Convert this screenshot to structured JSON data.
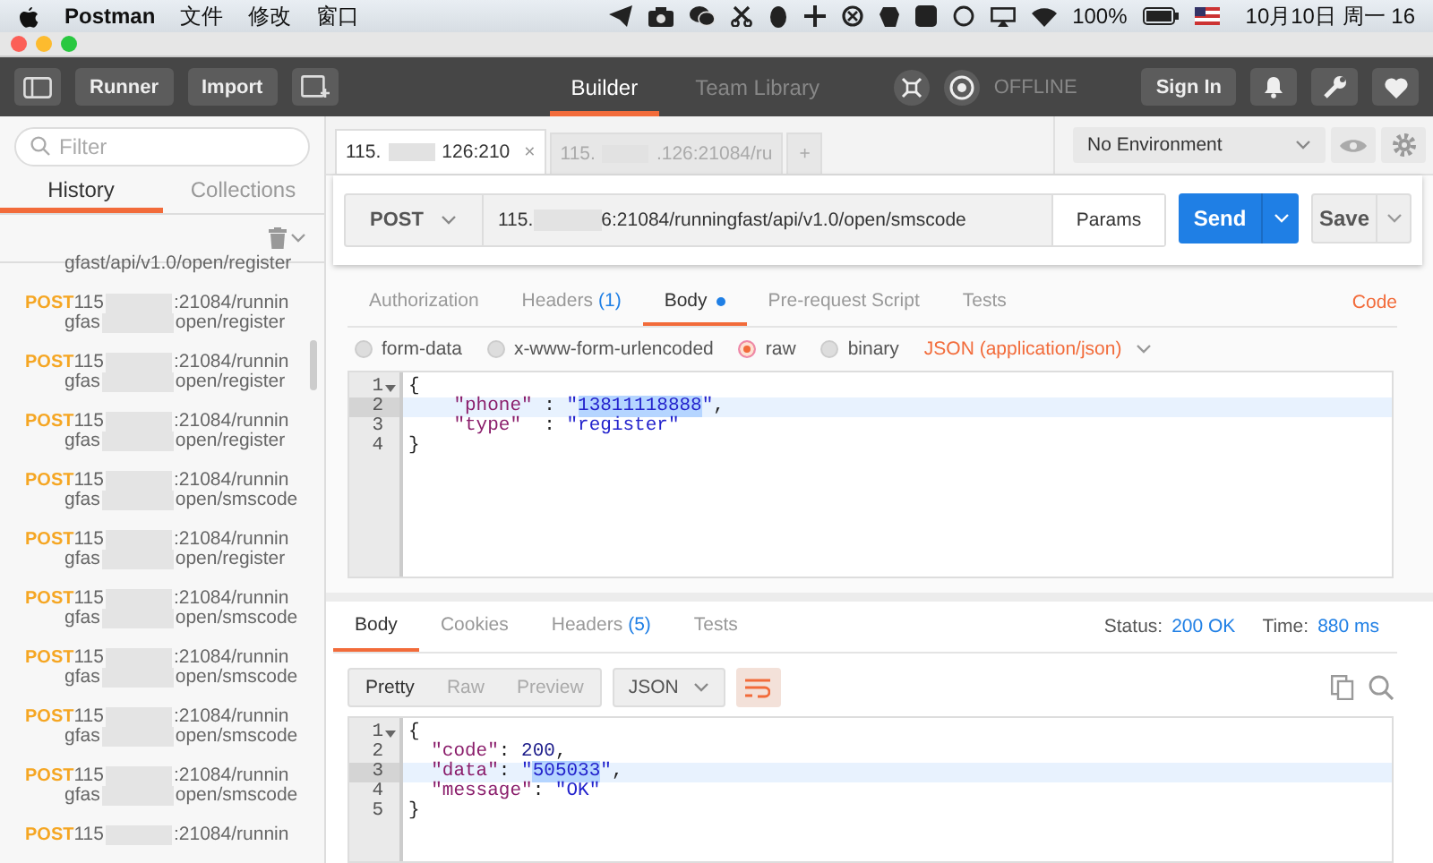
{
  "menubar": {
    "app": "Postman",
    "menus": [
      "文件",
      "修改",
      "窗口"
    ],
    "battery": "100%",
    "clock": "10月10日 周一 16"
  },
  "toolbar": {
    "buttons": [
      "Runner",
      "Import"
    ],
    "tabs": [
      {
        "label": "Builder",
        "selected": true
      },
      {
        "label": "Team Library",
        "selected": false
      }
    ],
    "sync_status": "OFFLINE",
    "sign_in": "Sign In"
  },
  "sidebar": {
    "filter_placeholder": "Filter",
    "tabs": [
      {
        "label": "History",
        "selected": true
      },
      {
        "label": "Collections",
        "selected": false
      }
    ],
    "history": [
      {
        "kind": "partial",
        "path": "gfast/api/v1.0/open/register"
      },
      {
        "kind": "full",
        "method": "POST",
        "url_head": "115",
        "url_tail": ":21084/runnin",
        "path_head": "gfas",
        "path_tail": "open/register"
      },
      {
        "kind": "full",
        "method": "POST",
        "url_head": "115",
        "url_tail": ":21084/runnin",
        "path_head": "gfas",
        "path_tail": "open/register"
      },
      {
        "kind": "full",
        "method": "POST",
        "url_head": "115",
        "url_tail": ":21084/runnin",
        "path_head": "gfas",
        "path_tail": "open/register"
      },
      {
        "kind": "full",
        "method": "POST",
        "url_head": "115",
        "url_tail": ":21084/runnin",
        "path_head": "gfas",
        "path_tail": "open/smscode"
      },
      {
        "kind": "full",
        "method": "POST",
        "url_head": "115",
        "url_tail": ":21084/runnin",
        "path_head": "gfas",
        "path_tail": "open/register"
      },
      {
        "kind": "full",
        "method": "POST",
        "url_head": "115",
        "url_tail": ":21084/runnin",
        "path_head": "gfas",
        "path_tail": "open/smscode"
      },
      {
        "kind": "full",
        "method": "POST",
        "url_head": "115",
        "url_tail": ":21084/runnin",
        "path_head": "gfas",
        "path_tail": "open/smscode"
      },
      {
        "kind": "full",
        "method": "POST",
        "url_head": "115",
        "url_tail": ":21084/runnin",
        "path_head": "gfas",
        "path_tail": "open/smscode"
      },
      {
        "kind": "full",
        "method": "POST",
        "url_head": "115",
        "url_tail": ":21084/runnin",
        "path_head": "gfas",
        "path_tail": "open/smscode"
      },
      {
        "kind": "full",
        "method": "POST",
        "url_head": "115",
        "url_tail": ":21084/runnin"
      }
    ]
  },
  "request_tabs": [
    {
      "head": "115.",
      "tail": "126:210",
      "selected": true,
      "close": "×"
    },
    {
      "head": "115.",
      "tail": ".126:21084/ru",
      "selected": false
    }
  ],
  "new_tab": "+",
  "environment": "No Environment",
  "request": {
    "method": "POST",
    "url_head": "115.",
    "url_tail": "6:21084/runningfast/api/v1.0/open/smscode",
    "params": "Params",
    "send": "Send",
    "save": "Save"
  },
  "request_sections": [
    {
      "label": "Authorization",
      "selected": false
    },
    {
      "label": "Headers",
      "count": "(1)",
      "selected": false
    },
    {
      "label": "Body",
      "selected": true,
      "dot": true
    },
    {
      "label": "Pre-request Script",
      "selected": false
    },
    {
      "label": "Tests",
      "selected": false
    }
  ],
  "code_link": "Code",
  "body_modes": [
    {
      "label": "form-data",
      "selected": false
    },
    {
      "label": "x-www-form-urlencoded",
      "selected": false
    },
    {
      "label": "raw",
      "selected": true
    },
    {
      "label": "binary",
      "selected": false
    }
  ],
  "content_type": "JSON (application/json)",
  "request_body": [
    {
      "number": "1",
      "foldable": true,
      "active": false,
      "tokens": [
        {
          "kind": "punct",
          "text": "{"
        }
      ]
    },
    {
      "number": "2",
      "foldable": false,
      "active": true,
      "tokens": [
        {
          "kind": "key",
          "text": "    \"phone\""
        },
        {
          "kind": "punct",
          "text": " : "
        },
        {
          "kind": "string",
          "text": "\""
        },
        {
          "kind": "selection",
          "text": "13811118888"
        },
        {
          "kind": "string",
          "text": "\""
        },
        {
          "kind": "punct",
          "text": ","
        }
      ]
    },
    {
      "number": "3",
      "foldable": false,
      "active": false,
      "tokens": [
        {
          "kind": "key",
          "text": "    \"type\""
        },
        {
          "kind": "punct",
          "text": "  : "
        },
        {
          "kind": "string",
          "text": "\"register\""
        }
      ]
    },
    {
      "number": "4",
      "foldable": false,
      "active": false,
      "tokens": [
        {
          "kind": "punct",
          "text": "}"
        }
      ]
    }
  ],
  "response": {
    "tabs": [
      {
        "label": "Body",
        "selected": true
      },
      {
        "label": "Cookies",
        "selected": false
      },
      {
        "label": "Headers",
        "count": "(5)",
        "selected": false
      },
      {
        "label": "Tests",
        "selected": false
      }
    ],
    "status_label": "Status:",
    "status": "200 OK",
    "time_label": "Time:",
    "time": "880 ms",
    "views": [
      {
        "label": "Pretty",
        "selected": true
      },
      {
        "label": "Raw",
        "selected": false
      },
      {
        "label": "Preview",
        "selected": false
      }
    ],
    "format": "JSON",
    "wrap": true,
    "body": [
      {
        "number": "1",
        "foldable": true,
        "active": false,
        "tokens": [
          {
            "kind": "punct",
            "text": "{"
          }
        ]
      },
      {
        "number": "2",
        "foldable": false,
        "active": false,
        "tokens": [
          {
            "kind": "key",
            "text": "  \"code\""
          },
          {
            "kind": "punct",
            "text": ": "
          },
          {
            "kind": "number",
            "text": "200"
          },
          {
            "kind": "punct",
            "text": ","
          }
        ]
      },
      {
        "number": "3",
        "foldable": false,
        "active": true,
        "tokens": [
          {
            "kind": "key",
            "text": "  \"data\""
          },
          {
            "kind": "punct",
            "text": ": "
          },
          {
            "kind": "string",
            "text": "\""
          },
          {
            "kind": "selection",
            "text": "505033"
          },
          {
            "kind": "string",
            "text": "\""
          },
          {
            "kind": "punct",
            "text": ","
          }
        ]
      },
      {
        "number": "4",
        "foldable": false,
        "active": false,
        "tokens": [
          {
            "kind": "key",
            "text": "  \"message\""
          },
          {
            "kind": "punct",
            "text": ": "
          },
          {
            "kind": "string",
            "text": "\"OK\""
          }
        ]
      },
      {
        "number": "5",
        "foldable": false,
        "active": false,
        "tokens": [
          {
            "kind": "punct",
            "text": "}"
          }
        ]
      }
    ]
  }
}
